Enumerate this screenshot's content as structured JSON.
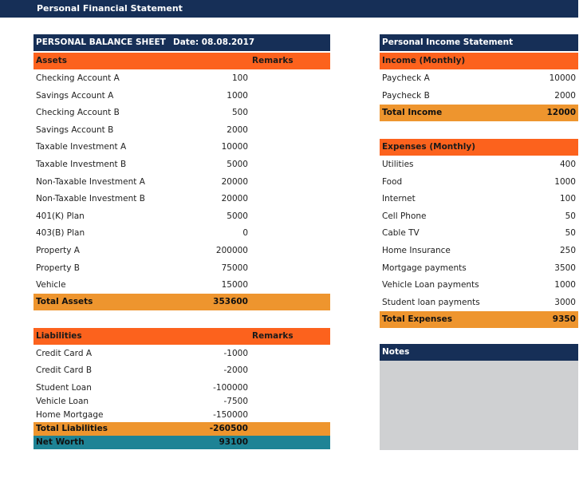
{
  "page_title": "Personal Financial Statement",
  "balance_sheet": {
    "title": "PERSONAL BALANCE SHEET",
    "date_label": "Date: 08.08.2017",
    "assets": {
      "header": "Assets",
      "remarks_header": "Remarks",
      "items": [
        {
          "label": "Checking Account A",
          "value": "100"
        },
        {
          "label": "Savings Account A",
          "value": "1000"
        },
        {
          "label": "Checking Account B",
          "value": "500"
        },
        {
          "label": "Savings Account B",
          "value": "2000"
        },
        {
          "label": "Taxable Investment A",
          "value": "10000"
        },
        {
          "label": "Taxable Investment B",
          "value": "5000"
        },
        {
          "label": "Non-Taxable Investment A",
          "value": "20000"
        },
        {
          "label": "Non-Taxable Investment B",
          "value": "20000"
        },
        {
          "label": "401(K) Plan",
          "value": "5000"
        },
        {
          "label": "403(B) Plan",
          "value": "0"
        },
        {
          "label": "Property A",
          "value": "200000"
        },
        {
          "label": "Property B",
          "value": "75000"
        },
        {
          "label": "Vehicle",
          "value": "15000"
        }
      ],
      "total_label": "Total Assets",
      "total_value": "353600"
    },
    "liabilities": {
      "header": "Liabilities",
      "remarks_header": "Remarks",
      "items": [
        {
          "label": "Credit Card A",
          "value": "-1000"
        },
        {
          "label": "Credit Card B",
          "value": "-2000"
        },
        {
          "label": "Student Loan",
          "value": "-100000"
        },
        {
          "label": "Vehicle Loan",
          "value": "-7500"
        },
        {
          "label": "Home Mortgage",
          "value": "-150000"
        }
      ],
      "total_label": "Total Liabilities",
      "total_value": "-260500"
    },
    "net_worth_label": "Net Worth",
    "net_worth_value": "93100"
  },
  "income_statement": {
    "title": "Personal Income Statement",
    "income": {
      "header": "Income (Monthly)",
      "items": [
        {
          "label": "Paycheck A",
          "value": "10000"
        },
        {
          "label": "Paycheck B",
          "value": "2000"
        }
      ],
      "total_label": "Total Income",
      "total_value": "12000"
    },
    "expenses": {
      "header": "Expenses (Monthly)",
      "items": [
        {
          "label": "Utilities",
          "value": "400"
        },
        {
          "label": "Food",
          "value": "1000"
        },
        {
          "label": "Internet",
          "value": "100"
        },
        {
          "label": "Cell Phone",
          "value": "50"
        },
        {
          "label": "Cable TV",
          "value": "50"
        },
        {
          "label": "Home Insurance",
          "value": "250"
        },
        {
          "label": "Mortgage payments",
          "value": "3500"
        },
        {
          "label": "Vehicle Loan payments",
          "value": "1000"
        },
        {
          "label": "Student loan payments",
          "value": "3000"
        }
      ],
      "total_label": "Total Expenses",
      "total_value": "9350"
    }
  },
  "notes": {
    "header": "Notes",
    "content": ""
  },
  "colors": {
    "navy": "#162f57",
    "orange": "#fc621d",
    "total": "#ee952e",
    "teal": "#1e8395",
    "notes_bg": "#cfd0d2"
  }
}
